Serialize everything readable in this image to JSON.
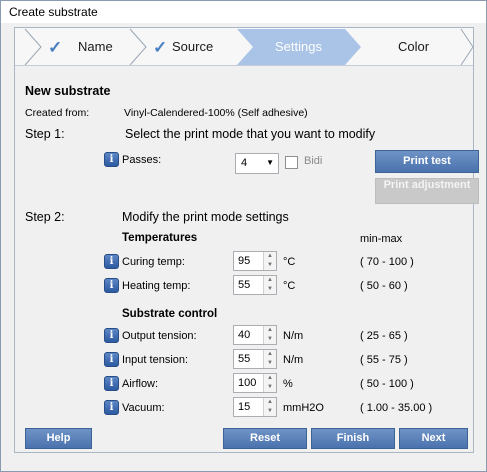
{
  "window": {
    "title": "Create substrate"
  },
  "wizard": {
    "steps": [
      {
        "label": "Name",
        "done": true
      },
      {
        "label": "Source",
        "done": true
      },
      {
        "label": "Settings",
        "active": true
      },
      {
        "label": "Color"
      }
    ]
  },
  "header": {
    "title": "New substrate",
    "created_from_label": "Created from:",
    "created_from_value": "Vinyl-Calendered-100% (Self adhesive)"
  },
  "step1": {
    "label": "Step 1:",
    "text": "Select the print mode that you want to modify",
    "passes_label": "Passes:",
    "passes_value": "4",
    "bidi_label": "Bidi",
    "bidi_checked": false,
    "print_test_label": "Print test",
    "print_adjustment_label": "Print adjustment"
  },
  "step2": {
    "label": "Step 2:",
    "text": "Modify the print mode settings",
    "minmax_header": "min-max",
    "temperatures": {
      "title": "Temperatures",
      "curing": {
        "label": "Curing temp:",
        "value": "95",
        "unit": "°C",
        "range": "( 70 - 100 )"
      },
      "heating": {
        "label": "Heating temp:",
        "value": "55",
        "unit": "°C",
        "range": "( 50 - 60 )"
      }
    },
    "substrate_control": {
      "title": "Substrate control",
      "output": {
        "label": "Output tension:",
        "value": "40",
        "unit": "N/m",
        "range": "( 25 - 65 )"
      },
      "input": {
        "label": "Input tension:",
        "value": "55",
        "unit": "N/m",
        "range": "( 55 - 75 )"
      },
      "airflow": {
        "label": "Airflow:",
        "value": "100",
        "unit": "%",
        "range": "( 50 - 100 )"
      },
      "vacuum": {
        "label": "Vacuum:",
        "value": "15",
        "unit": "mmH2O",
        "range": "( 1.00 - 35.00 )"
      }
    }
  },
  "footer": {
    "help_label": "Help",
    "reset_label": "Reset",
    "finish_label": "Finish",
    "next_label": "Next"
  },
  "colors": {
    "accent": "#5a80bd",
    "active_step": "#a9c4e6"
  },
  "icons": {
    "info": "info-icon",
    "check": "checkmark-icon",
    "spinner": "spinner-arrows-icon"
  }
}
